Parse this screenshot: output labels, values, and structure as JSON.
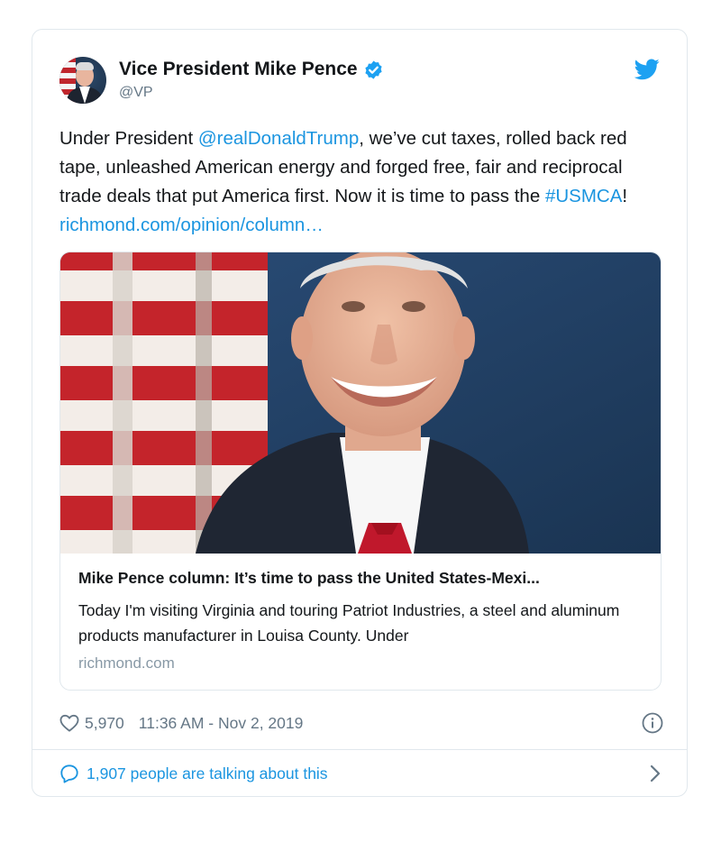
{
  "author": {
    "name": "Vice President Mike Pence",
    "handle": "@VP",
    "verified": true
  },
  "tweet": {
    "text_before_mention": "Under President ",
    "mention": "@realDonaldTrump",
    "text_middle": ", we’ve cut taxes, rolled back red tape, unleashed American energy and forged free, fair and reciprocal trade deals that put America first. Now it is time to pass the ",
    "hashtag": "#USMCA",
    "text_after_hashtag": "! ",
    "url": "richmond.com/opinion/column…"
  },
  "link_card": {
    "title": "Mike Pence column: It’s time to pass the United States-Mexi...",
    "description": "Today I'm visiting Virginia and touring Patriot Industries, a steel and aluminum products manufacturer in Louisa County. Under",
    "domain": "richmond.com"
  },
  "footer": {
    "likes": "5,970",
    "timestamp": "11:36 AM - Nov 2, 2019",
    "talking": "1,907 people are talking about this"
  },
  "colors": {
    "accent": "#1b95e0",
    "secondary_text": "#657786",
    "border": "#e1e8ed",
    "twitter_blue": "#1da1f2"
  },
  "icons": [
    "verified-badge-icon",
    "twitter-bird-icon",
    "heart-icon",
    "info-icon",
    "speech-bubble-icon",
    "chevron-right-icon"
  ]
}
